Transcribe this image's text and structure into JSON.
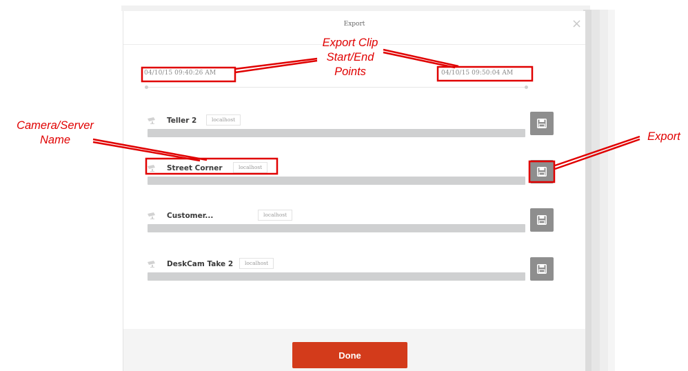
{
  "dialog": {
    "title": "Export",
    "start_time": "04/10/15 09:40:26 AM",
    "end_time": "04/10/15 09:50:04 AM",
    "done_label": "Done"
  },
  "cameras": [
    {
      "name": "Teller 2",
      "server": "localhost"
    },
    {
      "name": "Street Corner",
      "server": "localhost"
    },
    {
      "name": "Customer...",
      "server": "localhost"
    },
    {
      "name": "DeskCam Take 2",
      "server": "localhost"
    }
  ],
  "annotations": {
    "clip_line1": "Export Clip",
    "clip_line2": "Start/End",
    "clip_line3": "Points",
    "camera_line1": "Camera/Server",
    "camera_line2": "Name",
    "export": "Export"
  },
  "colors": {
    "accent": "#d33b1b",
    "annotation": "#e00000",
    "export_button": "#8e8e8e",
    "progress_bar": "#cfd0d1"
  },
  "icons": {
    "close": "close-icon",
    "camera": "camera-icon",
    "export": "save-icon"
  }
}
